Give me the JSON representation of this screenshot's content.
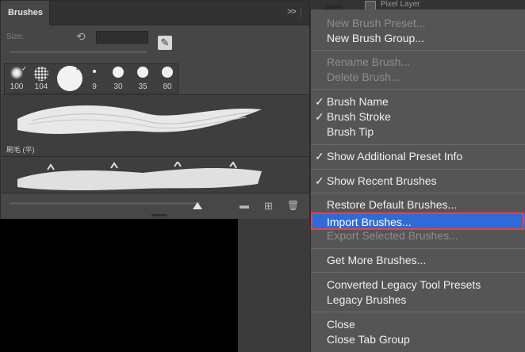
{
  "panel": {
    "tab_label": "Brushes",
    "collapse_glyph": ">>",
    "menu_glyph": "≡",
    "size_label": "Size:",
    "recent_brushes": [
      {
        "size": "100",
        "icon": "soft-round-brush-icon"
      },
      {
        "size": "104",
        "icon": "spatter-brush-icon"
      },
      {
        "size": "",
        "icon": "hard-round-brush-icon"
      },
      {
        "size": "9",
        "icon": "hard-round-brush-icon"
      },
      {
        "size": "30",
        "icon": "hard-round-brush-icon"
      },
      {
        "size": "35",
        "icon": "hard-round-brush-icon"
      },
      {
        "size": "80",
        "icon": "hard-round-brush-icon"
      }
    ],
    "presets": [
      {
        "name": ""
      },
      {
        "name": "刷毛 (平)"
      }
    ],
    "footer_icons": [
      "folder-icon",
      "new-brush-icon",
      "trash-icon"
    ]
  },
  "layers": {
    "layer_name": "Pixel Layer"
  },
  "menu": {
    "items": [
      {
        "label": "New Brush Preset...",
        "enabled": false,
        "checked": false
      },
      {
        "label": "New Brush Group...",
        "enabled": true,
        "checked": false
      },
      {
        "label": "Rename Brush...",
        "enabled": false,
        "checked": false
      },
      {
        "label": "Delete Brush...",
        "enabled": false,
        "checked": false
      },
      {
        "label": "Brush Name",
        "enabled": true,
        "checked": true
      },
      {
        "label": "Brush Stroke",
        "enabled": true,
        "checked": true
      },
      {
        "label": "Brush Tip",
        "enabled": true,
        "checked": false
      },
      {
        "label": "Show Additional Preset Info",
        "enabled": true,
        "checked": true
      },
      {
        "label": "Show Recent Brushes",
        "enabled": true,
        "checked": true
      },
      {
        "label": "Restore Default Brushes...",
        "enabled": true,
        "checked": false
      },
      {
        "label": "Import Brushes...",
        "enabled": true,
        "checked": false,
        "highlighted": true
      },
      {
        "label": "Export Selected Brushes...",
        "enabled": false,
        "checked": false
      },
      {
        "label": "Get More Brushes...",
        "enabled": true,
        "checked": false
      },
      {
        "label": "Converted Legacy Tool Presets",
        "enabled": true,
        "checked": false
      },
      {
        "label": "Legacy Brushes",
        "enabled": true,
        "checked": false
      },
      {
        "label": "Close",
        "enabled": true,
        "checked": false
      },
      {
        "label": "Close Tab Group",
        "enabled": true,
        "checked": false
      }
    ],
    "check_glyph": "✓",
    "highlight_color": "#2f6bd6",
    "callout_color": "#e0454a"
  }
}
